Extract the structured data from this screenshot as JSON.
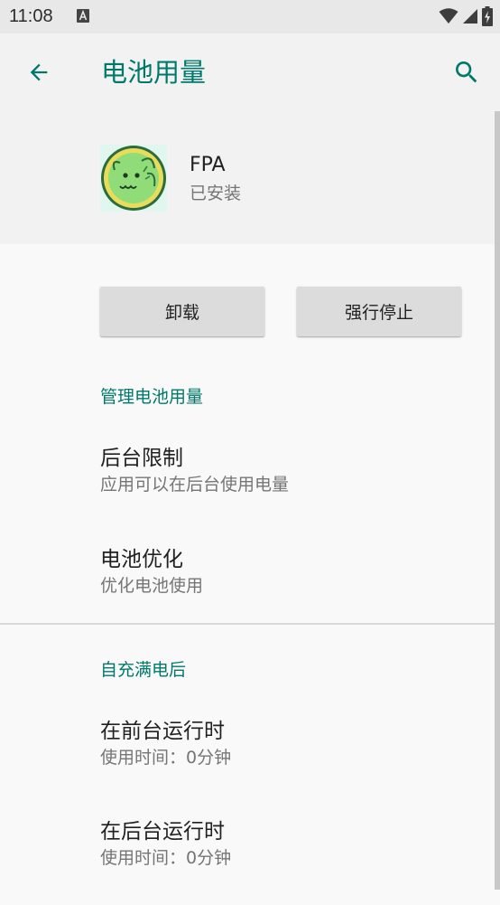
{
  "status_bar": {
    "time": "11:08"
  },
  "app_bar": {
    "title": "电池用量"
  },
  "app_info": {
    "name": "FPA",
    "status": "已安装"
  },
  "buttons": {
    "uninstall": "卸载",
    "force_stop": "强行停止"
  },
  "manage_section": {
    "header": "管理电池用量",
    "items": [
      {
        "title": "后台限制",
        "summary": "应用可以在后台使用电量"
      },
      {
        "title": "电池优化",
        "summary": "优化电池使用"
      }
    ]
  },
  "since_charge_section": {
    "header": "自充满电后",
    "items": [
      {
        "title": "在前台运行时",
        "summary": "使用时间：0分钟"
      },
      {
        "title": "在后台运行时",
        "summary": "使用时间：0分钟"
      }
    ]
  },
  "colors": {
    "accent": "#00796b",
    "status_bar_bg": "#e8e8e8",
    "header_bg": "#f2f2f2",
    "body_bg": "#f9f9f9"
  }
}
